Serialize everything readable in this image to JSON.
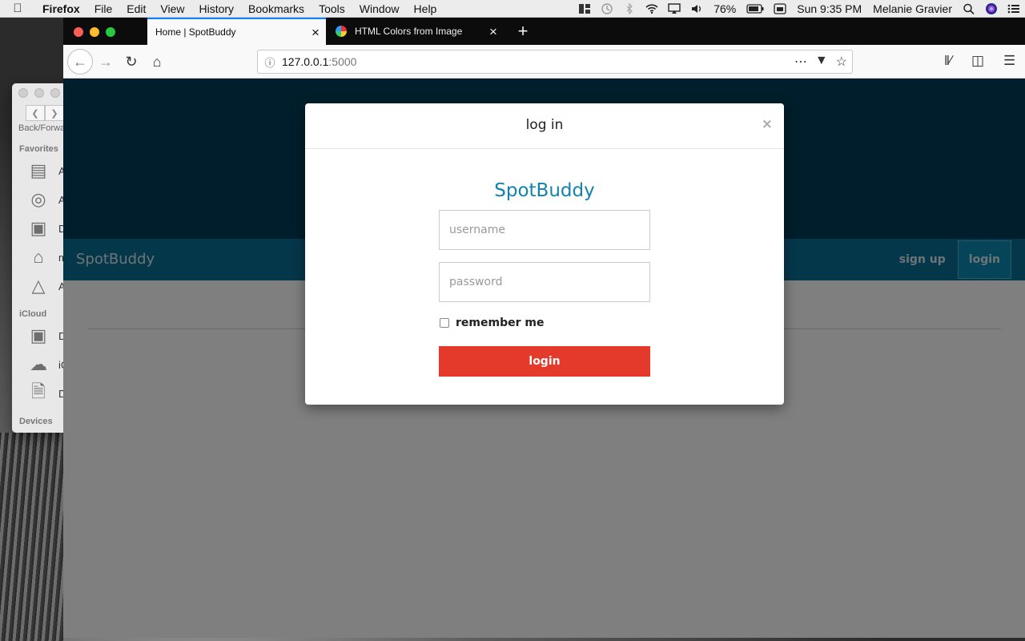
{
  "menubar": {
    "app": "Firefox",
    "items": [
      "File",
      "Edit",
      "View",
      "History",
      "Bookmarks",
      "Tools",
      "Window",
      "Help"
    ],
    "battery": "76%",
    "clock": "Sun 9:35 PM",
    "user": "Melanie Gravier"
  },
  "finder": {
    "back_forward_label": "Back/Forward",
    "favorites_label": "Favorites",
    "icloud_label": "iCloud",
    "devices_label": "Devices",
    "favorites": [
      "A",
      "A",
      "D",
      "m",
      "A"
    ],
    "icloud": [
      "D",
      "iC",
      "D"
    ]
  },
  "browser": {
    "tabs": [
      {
        "title": "Home | SpotBuddy"
      },
      {
        "title": "HTML Colors from Image"
      }
    ],
    "url_host": "127.0.0.1",
    "url_port": ":5000"
  },
  "site": {
    "brand": "SpotBuddy",
    "nav": [
      {
        "label": "sign up"
      },
      {
        "label": "login"
      }
    ]
  },
  "modal": {
    "title": "log in",
    "close": "×",
    "brand": "SpotBuddy",
    "username_placeholder": "username",
    "password_placeholder": "password",
    "remember_label": "remember me",
    "submit_label": "login"
  },
  "colors": {
    "hero": "#003d57",
    "nav": "#0b6f94",
    "brand_text": "#1283b0",
    "login_button": "#e33a2c"
  }
}
